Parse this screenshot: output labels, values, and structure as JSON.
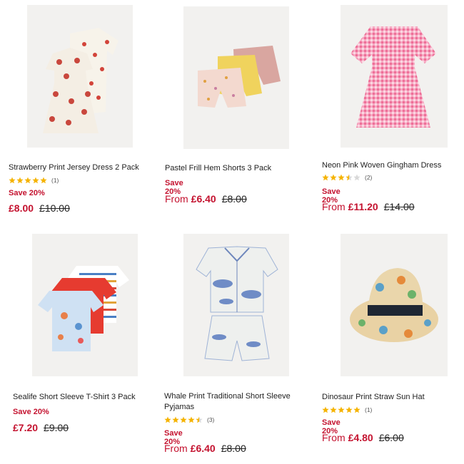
{
  "colors": {
    "sale_red": "#c4122f",
    "star_gold": "#f5b301",
    "star_empty": "#d8d8d8",
    "image_bg": "#f1f1f1"
  },
  "products": [
    {
      "title": "Strawberry Print Jersey Dress 2 Pack",
      "rating_stars": 5,
      "rating_count": "(1)",
      "save": "Save 20%",
      "price_prefix": "",
      "price_now": "£8.00",
      "price_was": "£10.00",
      "image_icon": "strawberry-dress-image"
    },
    {
      "title": "Pastel Frill Hem Shorts 3 Pack",
      "rating_stars": 0,
      "rating_count": "",
      "save": "Save 20%",
      "price_prefix": "From",
      "price_now": "£6.40",
      "price_was": "£8.00",
      "image_icon": "shorts-image"
    },
    {
      "title": "Neon Pink Woven Gingham Dress",
      "rating_stars": 3.5,
      "rating_count": "(2)",
      "save": "Save 20%",
      "price_prefix": "From",
      "price_now": "£11.20",
      "price_was": "£14.00",
      "image_icon": "gingham-dress-image"
    },
    {
      "title": "Sealife Short Sleeve T-Shirt 3 Pack",
      "rating_stars": 0,
      "rating_count": "",
      "save": "Save 20%",
      "price_prefix": "",
      "price_now": "£7.20",
      "price_was": "£9.00",
      "image_icon": "tshirts-image"
    },
    {
      "title": "Whale Print Traditional Short Sleeve Pyjamas",
      "rating_stars": 4.5,
      "rating_count": "(3)",
      "save": "Save 20%",
      "price_prefix": "From",
      "price_now": "£6.40",
      "price_was": "£8.00",
      "image_icon": "pyjamas-image"
    },
    {
      "title": "Dinosaur Print Straw Sun Hat",
      "rating_stars": 5,
      "rating_count": "(1)",
      "save": "Save 20%",
      "price_prefix": "From",
      "price_now": "£4.80",
      "price_was": "£6.00",
      "image_icon": "sun-hat-image"
    }
  ]
}
